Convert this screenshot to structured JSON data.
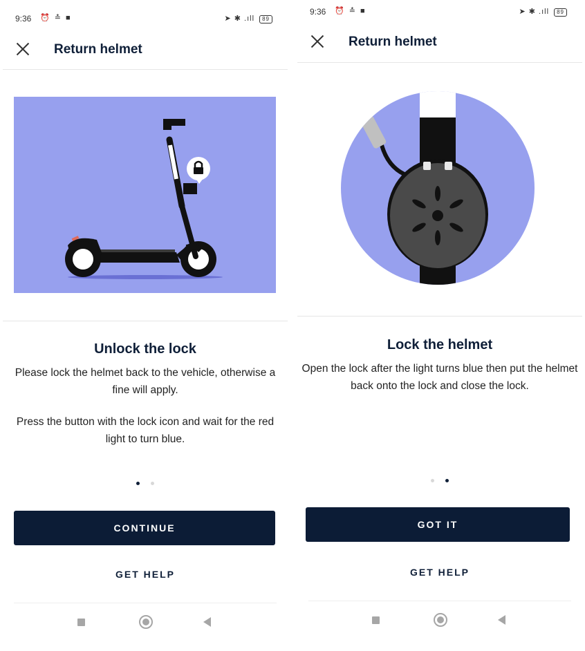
{
  "status_bar": {
    "time": "9:36",
    "battery": "89"
  },
  "screens": [
    {
      "header_title": "Return helmet",
      "heading": "Unlock the lock",
      "paragraph_1": "Please lock the helmet back to the vehicle, otherwise a fine will apply.",
      "paragraph_2": "Press the button with the lock icon and wait for the red light to turn blue.",
      "button_label": "CONTINUE",
      "help_label": "GET HELP",
      "page_index": 1,
      "page_count": 2
    },
    {
      "header_title": "Return helmet",
      "heading": "Lock the helmet",
      "paragraph_1": "Open the lock after the light turns blue then put the helmet back onto the lock and close the lock.",
      "button_label": "GOT IT",
      "help_label": "GET HELP",
      "page_index": 2,
      "page_count": 2
    }
  ],
  "icons": {
    "close": "close-icon",
    "lock": "lock-icon",
    "alarm": "alarm-icon",
    "video": "video-icon",
    "location": "location-arrow-icon",
    "bluetooth": "bluetooth-icon",
    "signal": "signal-icon",
    "battery": "battery-icon",
    "recent_apps": "square-icon",
    "home": "circle-icon",
    "back": "triangle-back-icon"
  },
  "colors": {
    "primary": "#0c1c36",
    "illustration_bg": "#97a0ee",
    "helmet": "#4a4a4a",
    "inactive_dot": "#d8d8d8"
  }
}
